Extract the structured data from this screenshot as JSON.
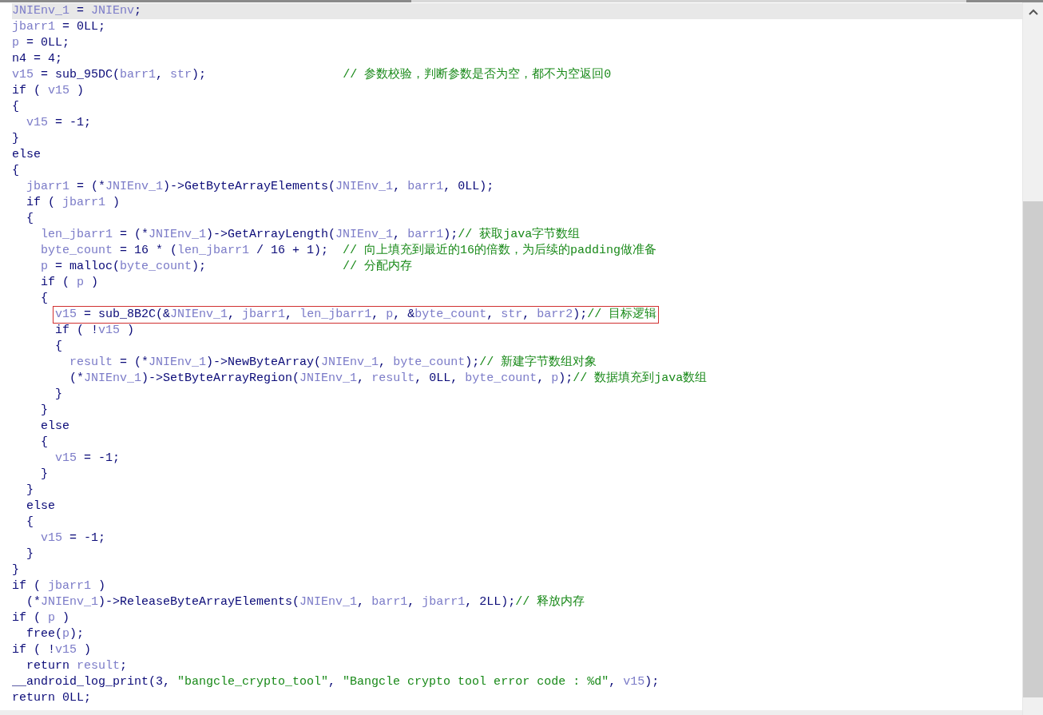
{
  "lines": [
    {
      "current": true,
      "boxed": false,
      "segments": [
        {
          "kind": "var",
          "text": "JNIEnv_1"
        },
        {
          "kind": "plain",
          "text": " = "
        },
        {
          "kind": "var",
          "text": "JNIEnv"
        },
        {
          "kind": "plain",
          "text": ";"
        }
      ]
    },
    {
      "current": false,
      "boxed": false,
      "segments": [
        {
          "kind": "var",
          "text": "jbarr1"
        },
        {
          "kind": "plain",
          "text": " = 0LL;"
        }
      ]
    },
    {
      "current": false,
      "boxed": false,
      "segments": [
        {
          "kind": "var",
          "text": "p"
        },
        {
          "kind": "plain",
          "text": " = 0LL;"
        }
      ]
    },
    {
      "current": false,
      "boxed": false,
      "segments": [
        {
          "kind": "plain",
          "text": "n4 = 4;"
        }
      ]
    },
    {
      "current": false,
      "boxed": false,
      "segments": [
        {
          "kind": "var",
          "text": "v15"
        },
        {
          "kind": "plain",
          "text": " = sub_95DC("
        },
        {
          "kind": "var",
          "text": "barr1"
        },
        {
          "kind": "plain",
          "text": ", "
        },
        {
          "kind": "var",
          "text": "str"
        },
        {
          "kind": "plain",
          "text": ");                   "
        },
        {
          "kind": "comment",
          "text": "// 参数校验，判断参数是否为空，都不为空返回0"
        }
      ]
    },
    {
      "current": false,
      "boxed": false,
      "segments": [
        {
          "kind": "plain",
          "text": "if ( "
        },
        {
          "kind": "var",
          "text": "v15"
        },
        {
          "kind": "plain",
          "text": " )"
        }
      ]
    },
    {
      "current": false,
      "boxed": false,
      "segments": [
        {
          "kind": "plain",
          "text": "{"
        }
      ]
    },
    {
      "current": false,
      "boxed": false,
      "segments": [
        {
          "kind": "var",
          "text": "  v15"
        },
        {
          "kind": "plain",
          "text": " = -1;"
        }
      ]
    },
    {
      "current": false,
      "boxed": false,
      "segments": [
        {
          "kind": "plain",
          "text": "}"
        }
      ]
    },
    {
      "current": false,
      "boxed": false,
      "segments": [
        {
          "kind": "plain",
          "text": "else"
        }
      ]
    },
    {
      "current": false,
      "boxed": false,
      "segments": [
        {
          "kind": "plain",
          "text": "{"
        }
      ]
    },
    {
      "current": false,
      "boxed": false,
      "segments": [
        {
          "kind": "var",
          "text": "  jbarr1"
        },
        {
          "kind": "plain",
          "text": " = (*"
        },
        {
          "kind": "var",
          "text": "JNIEnv_1"
        },
        {
          "kind": "plain",
          "text": ")->GetByteArrayElements("
        },
        {
          "kind": "var",
          "text": "JNIEnv_1"
        },
        {
          "kind": "plain",
          "text": ", "
        },
        {
          "kind": "var",
          "text": "barr1"
        },
        {
          "kind": "plain",
          "text": ", 0LL);"
        }
      ]
    },
    {
      "current": false,
      "boxed": false,
      "segments": [
        {
          "kind": "plain",
          "text": "  if ( "
        },
        {
          "kind": "var",
          "text": "jbarr1"
        },
        {
          "kind": "plain",
          "text": " )"
        }
      ]
    },
    {
      "current": false,
      "boxed": false,
      "segments": [
        {
          "kind": "plain",
          "text": "  {"
        }
      ]
    },
    {
      "current": false,
      "boxed": false,
      "segments": [
        {
          "kind": "var",
          "text": "    len_jbarr1"
        },
        {
          "kind": "plain",
          "text": " = (*"
        },
        {
          "kind": "var",
          "text": "JNIEnv_1"
        },
        {
          "kind": "plain",
          "text": ")->GetArrayLength("
        },
        {
          "kind": "var",
          "text": "JNIEnv_1"
        },
        {
          "kind": "plain",
          "text": ", "
        },
        {
          "kind": "var",
          "text": "barr1"
        },
        {
          "kind": "plain",
          "text": ");"
        },
        {
          "kind": "comment",
          "text": "// 获取java字节数组"
        }
      ]
    },
    {
      "current": false,
      "boxed": false,
      "segments": [
        {
          "kind": "var",
          "text": "    byte_count"
        },
        {
          "kind": "plain",
          "text": " = 16 * ("
        },
        {
          "kind": "var",
          "text": "len_jbarr1"
        },
        {
          "kind": "plain",
          "text": " / 16 + 1);  "
        },
        {
          "kind": "comment",
          "text": "// 向上填充到最近的16的倍数，为后续的padding做准备"
        }
      ]
    },
    {
      "current": false,
      "boxed": false,
      "segments": [
        {
          "kind": "var",
          "text": "    p"
        },
        {
          "kind": "plain",
          "text": " = malloc("
        },
        {
          "kind": "var",
          "text": "byte_count"
        },
        {
          "kind": "plain",
          "text": ");                   "
        },
        {
          "kind": "comment",
          "text": "// 分配内存"
        }
      ]
    },
    {
      "current": false,
      "boxed": false,
      "segments": [
        {
          "kind": "plain",
          "text": "    if ( "
        },
        {
          "kind": "var",
          "text": "p"
        },
        {
          "kind": "plain",
          "text": " )"
        }
      ]
    },
    {
      "current": false,
      "boxed": false,
      "segments": [
        {
          "kind": "plain",
          "text": "    {"
        }
      ]
    },
    {
      "current": false,
      "boxed": true,
      "segments": [
        {
          "kind": "var",
          "text": "      v15"
        },
        {
          "kind": "plain",
          "text": " = sub_8B2C(&"
        },
        {
          "kind": "var",
          "text": "JNIEnv_1"
        },
        {
          "kind": "plain",
          "text": ", "
        },
        {
          "kind": "var",
          "text": "jbarr1"
        },
        {
          "kind": "plain",
          "text": ", "
        },
        {
          "kind": "var",
          "text": "len_jbarr1"
        },
        {
          "kind": "plain",
          "text": ", "
        },
        {
          "kind": "var",
          "text": "p"
        },
        {
          "kind": "plain",
          "text": ", &"
        },
        {
          "kind": "var",
          "text": "byte_count"
        },
        {
          "kind": "plain",
          "text": ", "
        },
        {
          "kind": "var",
          "text": "str"
        },
        {
          "kind": "plain",
          "text": ", "
        },
        {
          "kind": "var",
          "text": "barr2"
        },
        {
          "kind": "plain",
          "text": ");"
        },
        {
          "kind": "comment",
          "text": "// 目标逻辑"
        }
      ]
    },
    {
      "current": false,
      "boxed": false,
      "segments": [
        {
          "kind": "plain",
          "text": "      if ( !"
        },
        {
          "kind": "var",
          "text": "v15"
        },
        {
          "kind": "plain",
          "text": " )"
        }
      ]
    },
    {
      "current": false,
      "boxed": false,
      "segments": [
        {
          "kind": "plain",
          "text": "      {"
        }
      ]
    },
    {
      "current": false,
      "boxed": false,
      "segments": [
        {
          "kind": "var",
          "text": "        result"
        },
        {
          "kind": "plain",
          "text": " = (*"
        },
        {
          "kind": "var",
          "text": "JNIEnv_1"
        },
        {
          "kind": "plain",
          "text": ")->NewByteArray("
        },
        {
          "kind": "var",
          "text": "JNIEnv_1"
        },
        {
          "kind": "plain",
          "text": ", "
        },
        {
          "kind": "var",
          "text": "byte_count"
        },
        {
          "kind": "plain",
          "text": ");"
        },
        {
          "kind": "comment",
          "text": "// 新建字节数组对象"
        }
      ]
    },
    {
      "current": false,
      "boxed": false,
      "segments": [
        {
          "kind": "plain",
          "text": "        (*"
        },
        {
          "kind": "var",
          "text": "JNIEnv_1"
        },
        {
          "kind": "plain",
          "text": ")->SetByteArrayRegion("
        },
        {
          "kind": "var",
          "text": "JNIEnv_1"
        },
        {
          "kind": "plain",
          "text": ", "
        },
        {
          "kind": "var",
          "text": "result"
        },
        {
          "kind": "plain",
          "text": ", 0LL, "
        },
        {
          "kind": "var",
          "text": "byte_count"
        },
        {
          "kind": "plain",
          "text": ", "
        },
        {
          "kind": "var",
          "text": "p"
        },
        {
          "kind": "plain",
          "text": ");"
        },
        {
          "kind": "comment",
          "text": "// 数据填充到java数组"
        }
      ]
    },
    {
      "current": false,
      "boxed": false,
      "segments": [
        {
          "kind": "plain",
          "text": "      }"
        }
      ]
    },
    {
      "current": false,
      "boxed": false,
      "segments": [
        {
          "kind": "plain",
          "text": "    }"
        }
      ]
    },
    {
      "current": false,
      "boxed": false,
      "segments": [
        {
          "kind": "plain",
          "text": "    else"
        }
      ]
    },
    {
      "current": false,
      "boxed": false,
      "segments": [
        {
          "kind": "plain",
          "text": "    {"
        }
      ]
    },
    {
      "current": false,
      "boxed": false,
      "segments": [
        {
          "kind": "var",
          "text": "      v15"
        },
        {
          "kind": "plain",
          "text": " = -1;"
        }
      ]
    },
    {
      "current": false,
      "boxed": false,
      "segments": [
        {
          "kind": "plain",
          "text": "    }"
        }
      ]
    },
    {
      "current": false,
      "boxed": false,
      "segments": [
        {
          "kind": "plain",
          "text": "  }"
        }
      ]
    },
    {
      "current": false,
      "boxed": false,
      "segments": [
        {
          "kind": "plain",
          "text": "  else"
        }
      ]
    },
    {
      "current": false,
      "boxed": false,
      "segments": [
        {
          "kind": "plain",
          "text": "  {"
        }
      ]
    },
    {
      "current": false,
      "boxed": false,
      "segments": [
        {
          "kind": "var",
          "text": "    v15"
        },
        {
          "kind": "plain",
          "text": " = -1;"
        }
      ]
    },
    {
      "current": false,
      "boxed": false,
      "segments": [
        {
          "kind": "plain",
          "text": "  }"
        }
      ]
    },
    {
      "current": false,
      "boxed": false,
      "segments": [
        {
          "kind": "plain",
          "text": "}"
        }
      ]
    },
    {
      "current": false,
      "boxed": false,
      "segments": [
        {
          "kind": "plain",
          "text": "if ( "
        },
        {
          "kind": "var",
          "text": "jbarr1"
        },
        {
          "kind": "plain",
          "text": " )"
        }
      ]
    },
    {
      "current": false,
      "boxed": false,
      "segments": [
        {
          "kind": "plain",
          "text": "  (*"
        },
        {
          "kind": "var",
          "text": "JNIEnv_1"
        },
        {
          "kind": "plain",
          "text": ")->ReleaseByteArrayElements("
        },
        {
          "kind": "var",
          "text": "JNIEnv_1"
        },
        {
          "kind": "plain",
          "text": ", "
        },
        {
          "kind": "var",
          "text": "barr1"
        },
        {
          "kind": "plain",
          "text": ", "
        },
        {
          "kind": "var",
          "text": "jbarr1"
        },
        {
          "kind": "plain",
          "text": ", 2LL);"
        },
        {
          "kind": "comment",
          "text": "// 释放内存"
        }
      ]
    },
    {
      "current": false,
      "boxed": false,
      "segments": [
        {
          "kind": "plain",
          "text": "if ( "
        },
        {
          "kind": "var",
          "text": "p"
        },
        {
          "kind": "plain",
          "text": " )"
        }
      ]
    },
    {
      "current": false,
      "boxed": false,
      "segments": [
        {
          "kind": "plain",
          "text": "  free("
        },
        {
          "kind": "var",
          "text": "p"
        },
        {
          "kind": "plain",
          "text": ");"
        }
      ]
    },
    {
      "current": false,
      "boxed": false,
      "segments": [
        {
          "kind": "plain",
          "text": "if ( !"
        },
        {
          "kind": "var",
          "text": "v15"
        },
        {
          "kind": "plain",
          "text": " )"
        }
      ]
    },
    {
      "current": false,
      "boxed": false,
      "segments": [
        {
          "kind": "plain",
          "text": "  return "
        },
        {
          "kind": "var",
          "text": "result"
        },
        {
          "kind": "plain",
          "text": ";"
        }
      ]
    },
    {
      "current": false,
      "boxed": false,
      "segments": [
        {
          "kind": "plain",
          "text": "__android_log_print(3, "
        },
        {
          "kind": "string",
          "text": "\"bangcle_crypto_tool\""
        },
        {
          "kind": "plain",
          "text": ", "
        },
        {
          "kind": "string",
          "text": "\"Bangcle crypto tool error code : %d\""
        },
        {
          "kind": "plain",
          "text": ", "
        },
        {
          "kind": "var",
          "text": "v15"
        },
        {
          "kind": "plain",
          "text": ");"
        }
      ]
    },
    {
      "current": false,
      "boxed": false,
      "segments": [
        {
          "kind": "plain",
          "text": "return 0LL;"
        }
      ]
    }
  ]
}
